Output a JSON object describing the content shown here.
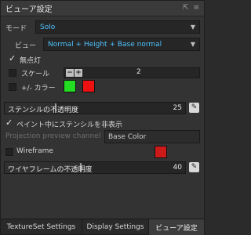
{
  "panel": {
    "title": "ビューア設定",
    "title_icons": [
      "⇱",
      "≡"
    ]
  },
  "mode": {
    "label": "モード",
    "value": "Solo"
  },
  "viewer": {
    "label": "ビュー",
    "value": "Normal + Height + Base normal"
  },
  "unlit": {
    "label": "無点灯",
    "checked": true
  },
  "scale": {
    "label": "スケール",
    "value": "2"
  },
  "plusminus_color": {
    "label": "+/- カラー",
    "plus_color": "#22dd22",
    "minus_color": "#ee1111"
  },
  "stencil_opacity": {
    "label": "ステンシルの不透明度",
    "value": "25"
  },
  "hide_stencil": {
    "label": "ペイント中にステンシルを非表示",
    "checked": true
  },
  "projection": {
    "label": "Projection preview channel",
    "value": "Base Color"
  },
  "wireframe": {
    "label": "Wireframe",
    "checked": false,
    "color": "#cc1a1a"
  },
  "wire_opacity": {
    "label": "ワイヤフレームの不透明度",
    "value": "40"
  },
  "tabs": [
    {
      "label": "TextureSet Settings"
    },
    {
      "label": "Display Settings"
    },
    {
      "label": "ビューア設定"
    }
  ]
}
